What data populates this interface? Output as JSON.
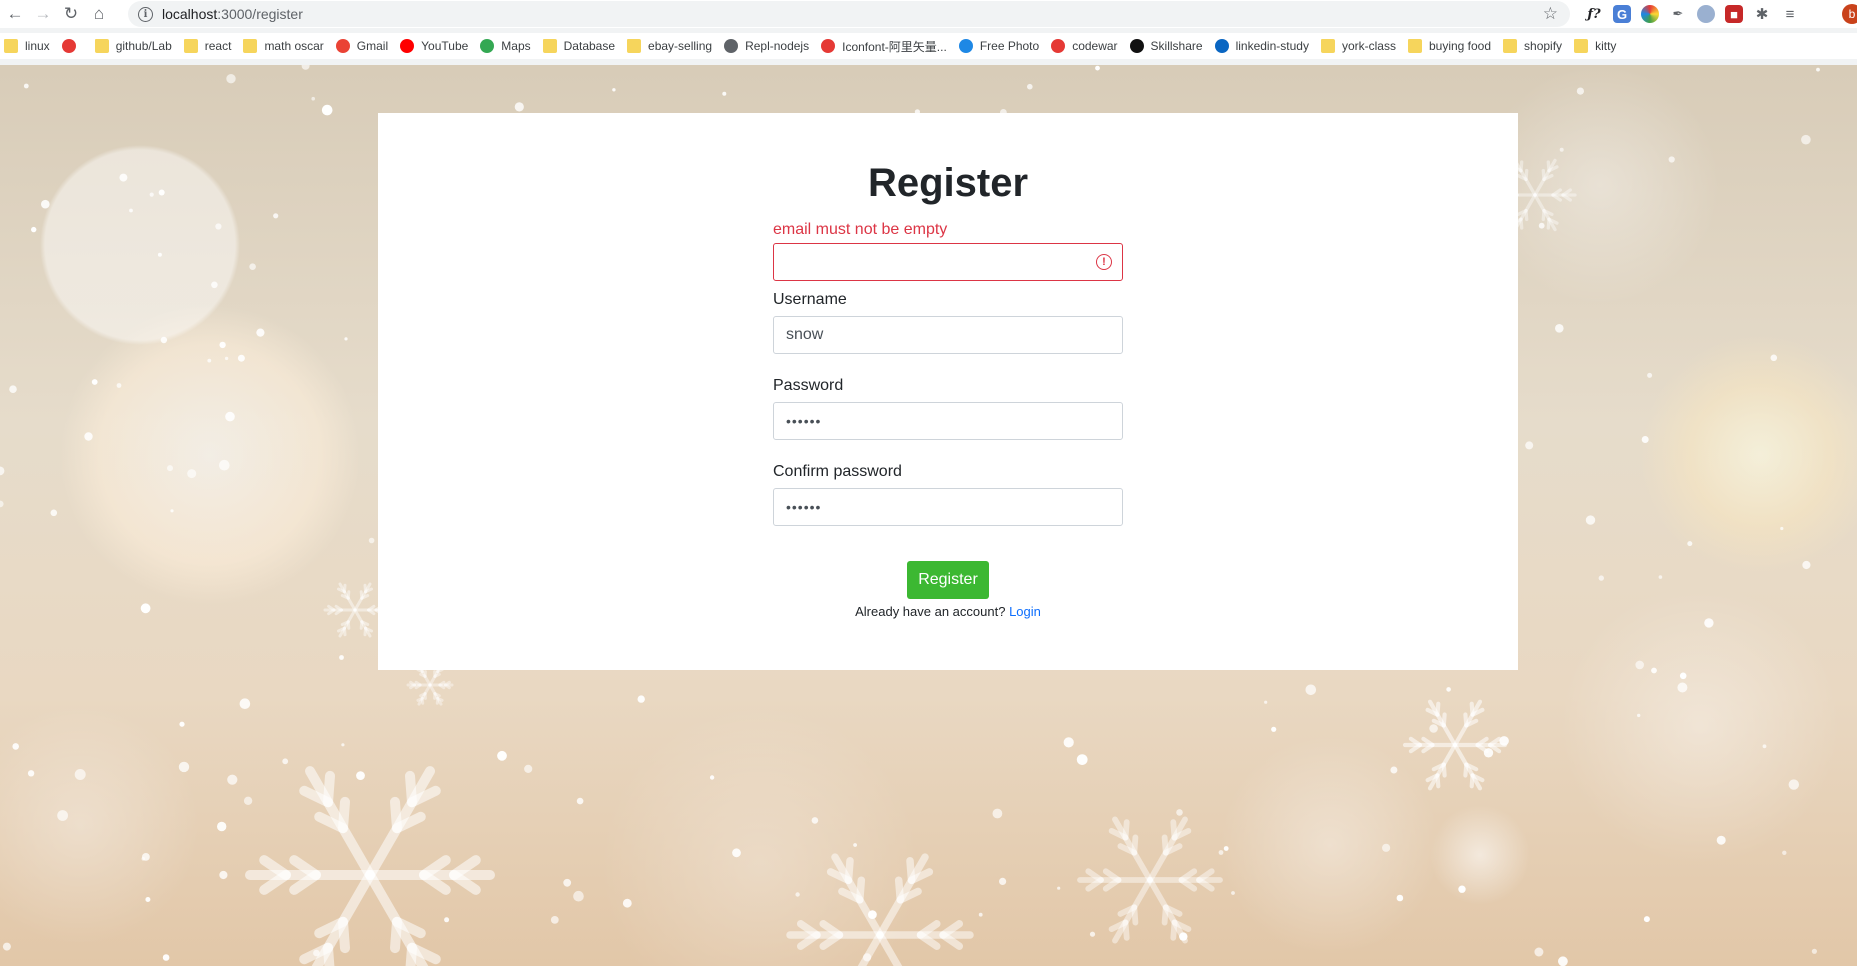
{
  "browser": {
    "url_host": "localhost",
    "url_path": ":3000/register",
    "avatar_letter": "b"
  },
  "bookmarks": [
    {
      "label": "linux",
      "icon": "folder-icon",
      "color": "#f6d55c"
    },
    {
      "label": "",
      "icon": "app-icon",
      "color": "#e53935"
    },
    {
      "label": "github/Lab",
      "icon": "folder-icon",
      "color": "#f6d55c"
    },
    {
      "label": "react",
      "icon": "folder-icon",
      "color": "#f6d55c"
    },
    {
      "label": "math oscar",
      "icon": "folder-icon",
      "color": "#f6d55c"
    },
    {
      "label": "Gmail",
      "icon": "gmail-icon",
      "color": "#ea4335"
    },
    {
      "label": "YouTube",
      "icon": "youtube-icon",
      "color": "#ff0000"
    },
    {
      "label": "Maps",
      "icon": "maps-icon",
      "color": "#34a853"
    },
    {
      "label": "Database",
      "icon": "folder-icon",
      "color": "#f6d55c"
    },
    {
      "label": "ebay-selling",
      "icon": "folder-icon",
      "color": "#f6d55c"
    },
    {
      "label": "Repl-nodejs",
      "icon": "replit-icon",
      "color": "#5f6368"
    },
    {
      "label": "Iconfont-阿里矢量...",
      "icon": "iconfont-icon",
      "color": "#e53935"
    },
    {
      "label": "Free Photo",
      "icon": "freephoto-icon",
      "color": "#1e88e5"
    },
    {
      "label": "codewar",
      "icon": "codewar-icon",
      "color": "#e53935"
    },
    {
      "label": "Skillshare",
      "icon": "skillshare-icon",
      "color": "#111111"
    },
    {
      "label": "linkedin-study",
      "icon": "linkedin-icon",
      "color": "#0a66c2"
    },
    {
      "label": "york-class",
      "icon": "folder-icon",
      "color": "#f6d55c"
    },
    {
      "label": "buying food",
      "icon": "folder-icon",
      "color": "#f6d55c"
    },
    {
      "label": "shopify",
      "icon": "folder-icon",
      "color": "#f6d55c"
    },
    {
      "label": "kitty",
      "icon": "folder-icon",
      "color": "#f6d55c"
    }
  ],
  "form": {
    "title": "Register",
    "email_error": "email must not be empty",
    "email_value": "",
    "username_label": "Username",
    "username_value": "snow",
    "password_label": "Password",
    "password_value": "••••••",
    "confirm_label": "Confirm password",
    "confirm_value": "••••••",
    "submit_label": "Register",
    "footer_text": "Already have an account?",
    "login_link": "Login"
  },
  "colors": {
    "error": "#dc3545",
    "button": "#3cb832",
    "link": "#0d6efd"
  }
}
